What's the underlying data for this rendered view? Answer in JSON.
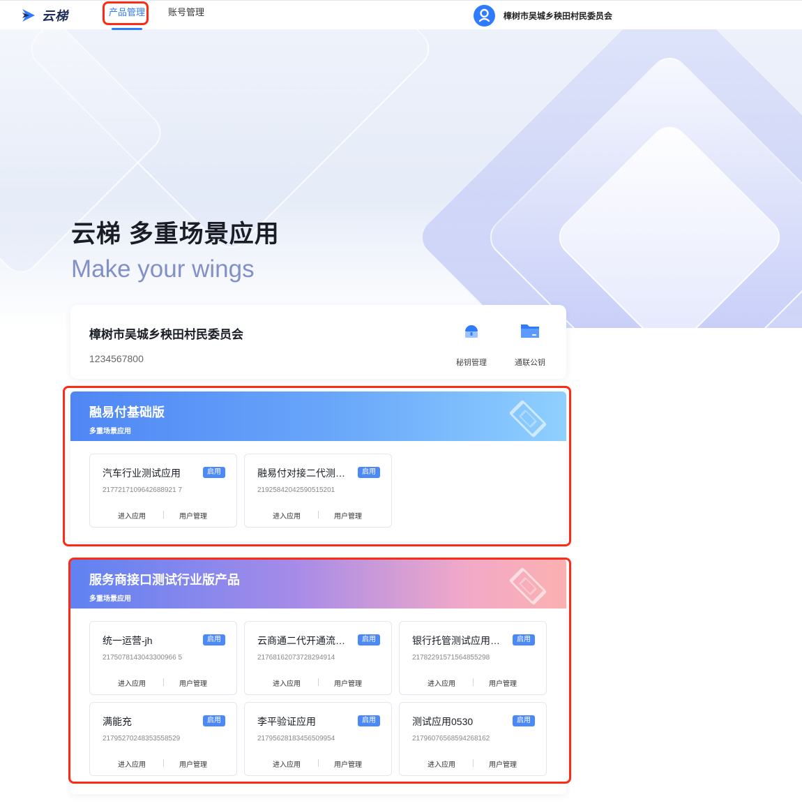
{
  "nav": {
    "logo_text": "云梯",
    "tabs": [
      {
        "label": "产品管理",
        "active": true
      },
      {
        "label": "账号管理",
        "active": false
      }
    ],
    "user_name": "樟树市吴城乡秧田村民委员会"
  },
  "hero": {
    "title": "云梯 多重场景应用",
    "subtitle": "Make your wings"
  },
  "org": {
    "name": "樟树市吴城乡秧田村民委员会",
    "id": "1234567800",
    "actions": [
      {
        "label": "秘钥管理",
        "icon": "lock-icon"
      },
      {
        "label": "通联公钥",
        "icon": "folder-icon"
      }
    ]
  },
  "products": [
    {
      "title": "融易付基础版",
      "subtitle": "多重场景应用",
      "apps": [
        {
          "name": "汽车行业测试应用",
          "status": "启用",
          "id": "2177217109642688921 7",
          "enter": "进入应用",
          "users": "用户管理"
        },
        {
          "name": "融易付对接二代测…",
          "status": "启用",
          "id": "21925842042590515201",
          "enter": "进入应用",
          "users": "用户管理"
        }
      ]
    },
    {
      "title": "服务商接口测试行业版产品",
      "subtitle": "多重场景应用",
      "apps": [
        {
          "name": "统一运营-jh",
          "status": "启用",
          "id": "2175078143043300966 5",
          "enter": "进入应用",
          "users": "用户管理"
        },
        {
          "name": "云商通二代开通流…",
          "status": "启用",
          "id": "21768162073728294914",
          "enter": "进入应用",
          "users": "用户管理"
        },
        {
          "name": "银行托管测试应用…",
          "status": "启用",
          "id": "21782291571564855298",
          "enter": "进入应用",
          "users": "用户管理"
        },
        {
          "name": "满能充",
          "status": "启用",
          "id": "21795270248353558529",
          "enter": "进入应用",
          "users": "用户管理"
        },
        {
          "name": "李平验证应用",
          "status": "启用",
          "id": "21795628183456509954",
          "enter": "进入应用",
          "users": "用户管理"
        },
        {
          "name": "测试应用0530",
          "status": "启用",
          "id": "21796076568594268162",
          "enter": "进入应用",
          "users": "用户管理"
        }
      ]
    }
  ],
  "colors": {
    "brand": "#2f7bff",
    "highlight": "#ff2a16",
    "badge": "#4b89f7"
  }
}
